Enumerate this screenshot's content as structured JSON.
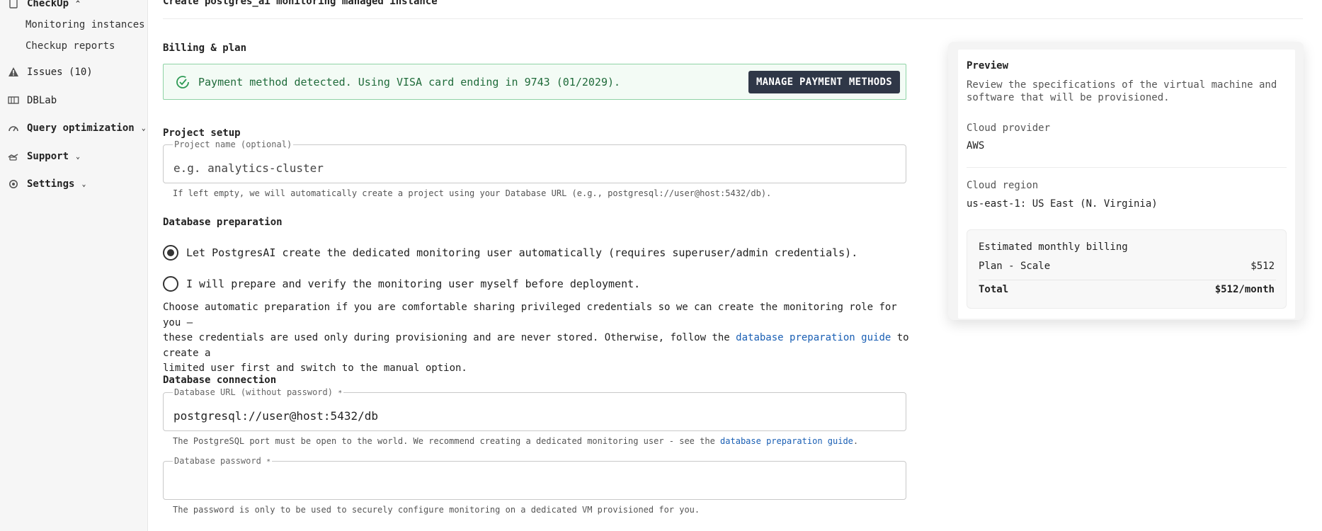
{
  "sidebar": {
    "checkup": "CheckUp",
    "monitoring_instances": "Monitoring instances",
    "checkup_reports": "Checkup reports",
    "issues": "Issues (10)",
    "dblab": "DBLab",
    "query_optimization": "Query optimization",
    "support": "Support",
    "settings": "Settings"
  },
  "header": {
    "title": "Create postgres_ai monitoring managed instance"
  },
  "billing": {
    "section_title": "Billing & plan",
    "message": "Payment method detected. Using VISA card ending in 9743 (01/2029).",
    "manage_button": "MANAGE PAYMENT METHODS"
  },
  "project": {
    "section_title": "Project setup",
    "label": "Project name (optional)",
    "placeholder": "e.g. analytics-cluster",
    "helper": "If left empty, we will automatically create a project using your Database URL (e.g., postgresql://user@host:5432/db)."
  },
  "prep": {
    "section_title": "Database preparation",
    "option_auto": "Let PostgresAI create the dedicated monitoring user automatically (requires superuser/admin credentials).",
    "option_manual": "I will prepare and verify the monitoring user myself before deployment.",
    "para_1": "Choose automatic preparation if you are comfortable sharing privileged credentials so we can create the monitoring role for you —",
    "para_2_pre": "these credentials are used only during provisioning and are never stored. Otherwise, follow the ",
    "para_2_link": "database preparation guide",
    "para_2_post": " to create a",
    "para_3": "limited user first and switch to the manual option."
  },
  "connection": {
    "section_title": "Database connection",
    "url_label": "Database URL (without password)",
    "url_value": "postgresql://user@host:5432/db",
    "url_helper_pre": "The PostgreSQL port must be open to the world. We recommend creating a dedicated monitoring user - see the ",
    "url_helper_link": "database preparation guide",
    "url_helper_post": ".",
    "password_label": "Database password",
    "password_helper": "The password is only to be used to securely configure monitoring on a dedicated VM provisioned for you.",
    "required_mark": "*"
  },
  "preview": {
    "title": "Preview",
    "desc_1": "Review the specifications of the virtual machine and",
    "desc_2": "software that will be provisioned.",
    "cloud_provider_label": "Cloud provider",
    "cloud_provider_value": "AWS",
    "cloud_region_label": "Cloud region",
    "cloud_region_value": "us-east-1: US East (N. Virginia)",
    "billing_title": "Estimated monthly billing",
    "plan_label": "Plan - Scale",
    "plan_price": "$512",
    "total_label": "Total",
    "total_price": "$512/month"
  },
  "colors": {
    "success_border": "#8fd3a6",
    "success_text": "#1f6b3a",
    "button_bg": "#2f3747",
    "link": "#1a5fb4"
  }
}
